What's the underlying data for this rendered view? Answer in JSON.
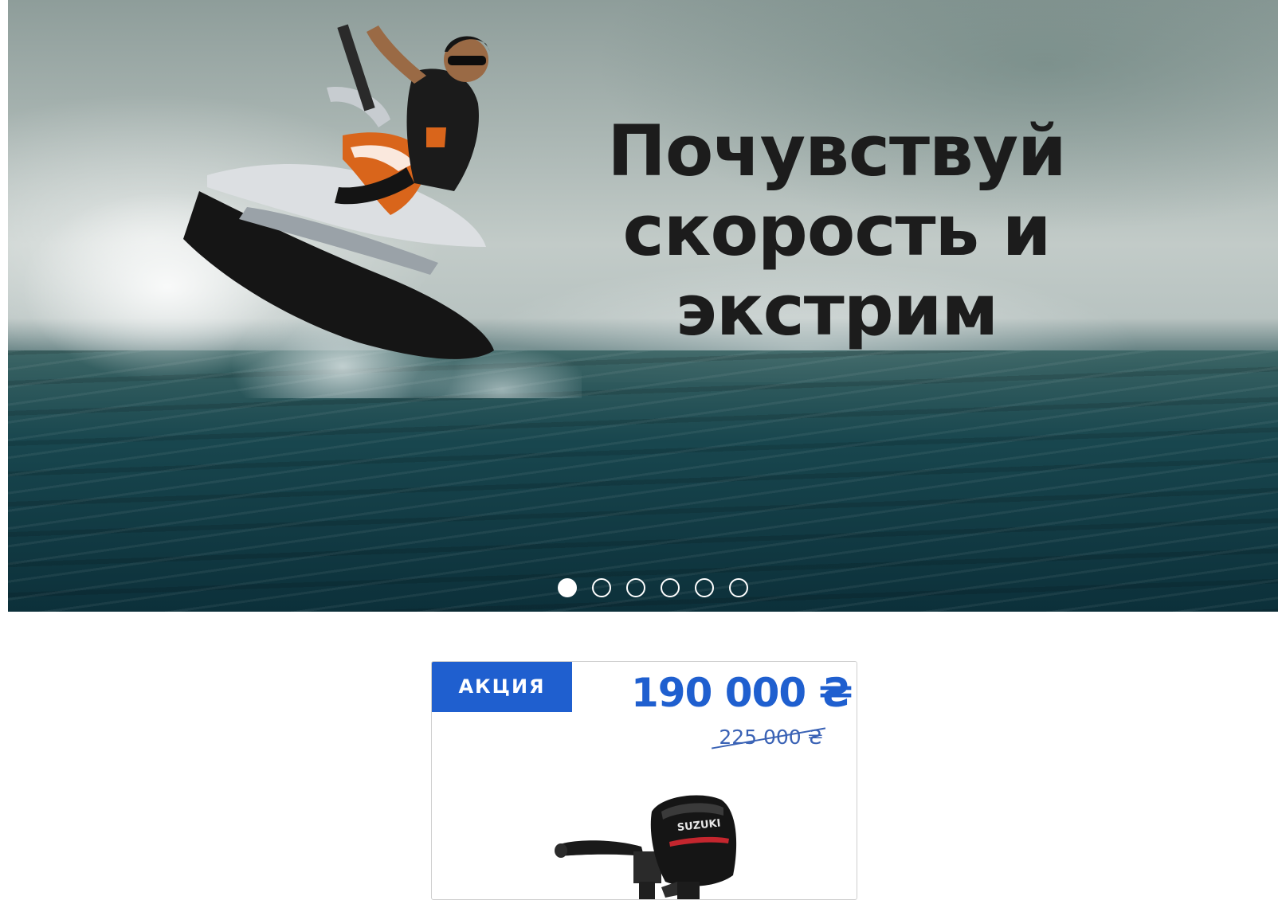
{
  "hero": {
    "headline_line1": "Почувствуй",
    "headline_line2": "скорость и",
    "headline_line3": "экстрим",
    "slide_count": 6,
    "active_slide": 1
  },
  "product": {
    "badge": "АКЦИЯ",
    "price_current": "190 000 ₴",
    "price_old": "225 000 ₴",
    "image_brand_text": "SUZUKI"
  },
  "colors": {
    "accent": "#1f5fcf",
    "headline": "#1c1c1c"
  }
}
